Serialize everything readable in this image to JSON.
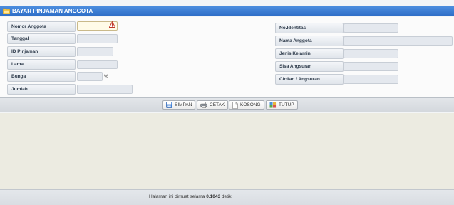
{
  "window": {
    "title": "BAYAR PINJAMAN ANGGOTA",
    "title_icon": "folder-icon"
  },
  "form_left": {
    "fields": [
      {
        "label": "Nomor Anggota",
        "value": ""
      },
      {
        "label": "Tanggal",
        "value": ""
      },
      {
        "label": "ID Pinjaman",
        "value": ""
      },
      {
        "label": "Lama",
        "value": ""
      },
      {
        "label": "Bunga",
        "value": "",
        "suffix": "%"
      },
      {
        "label": "Jumlah",
        "value": ""
      }
    ]
  },
  "form_right": {
    "fields": [
      {
        "label": "No.Identitas",
        "value": ""
      },
      {
        "label": "Nama Anggota",
        "value": ""
      },
      {
        "label": "Jenis Kelamin",
        "value": ""
      },
      {
        "label": "Sisa Angsuran",
        "value": ""
      },
      {
        "label": "Cicilan / Angsuran",
        "value": ""
      }
    ]
  },
  "toolbar": {
    "simpan": "SIMPAN",
    "cetak": "CETAK",
    "kosong": "KOSONG",
    "tutup": "TUTUP"
  },
  "footer": {
    "prefix": "Halaman ini dimuat selama",
    "time": "0.1043",
    "suffix": "detik"
  },
  "colors": {
    "title_bar": "#2f6fc8",
    "warning": "#c0392b",
    "content_bg": "#ecebe1"
  }
}
